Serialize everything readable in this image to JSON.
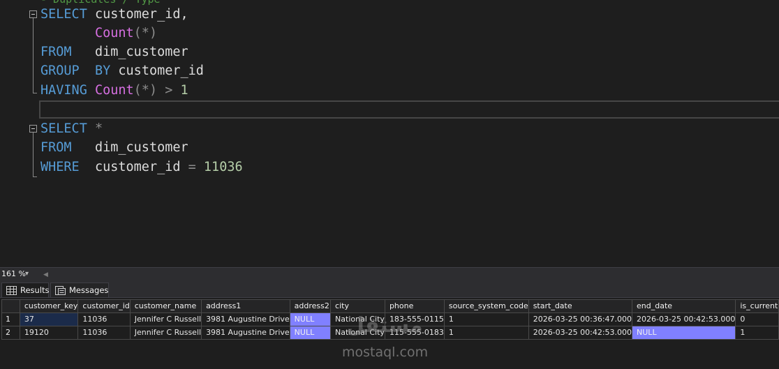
{
  "editor": {
    "top_partial": "- Duplicates / Type",
    "lines": [
      {
        "tokens": [
          [
            "kw",
            "SELECT"
          ],
          [
            "pl",
            " customer_id,"
          ]
        ]
      },
      {
        "tokens": [
          [
            "pl",
            "       "
          ],
          [
            "fn",
            "Count"
          ],
          [
            "op",
            "(*)"
          ]
        ]
      },
      {
        "tokens": [
          [
            "kw",
            "FROM"
          ],
          [
            "pl",
            "   dim_customer"
          ]
        ]
      },
      {
        "tokens": [
          [
            "kw",
            "GROUP"
          ],
          [
            "pl",
            "  "
          ],
          [
            "kw",
            "BY"
          ],
          [
            "pl",
            " customer_id"
          ]
        ]
      },
      {
        "tokens": [
          [
            "kw",
            "HAVING"
          ],
          [
            "pl",
            " "
          ],
          [
            "fn",
            "Count"
          ],
          [
            "op",
            "(*) > "
          ],
          [
            "num",
            "1"
          ]
        ]
      },
      {
        "tokens": []
      },
      {
        "tokens": [
          [
            "kw",
            "SELECT"
          ],
          [
            "pl",
            " "
          ],
          [
            "op",
            "*"
          ]
        ]
      },
      {
        "tokens": [
          [
            "kw",
            "FROM"
          ],
          [
            "pl",
            "   dim_customer"
          ]
        ]
      },
      {
        "tokens": [
          [
            "kw",
            "WHERE"
          ],
          [
            "pl",
            "  customer_id "
          ],
          [
            "op",
            "="
          ],
          [
            "pl",
            " "
          ],
          [
            "num",
            "11036"
          ]
        ]
      }
    ]
  },
  "zoom": {
    "level": "161 %",
    "dropdown_icon": "chevron-down-icon"
  },
  "tabs": {
    "results": "Results",
    "messages": "Messages"
  },
  "grid": {
    "columns": [
      "customer_key",
      "customer_id",
      "customer_name",
      "address1",
      "address2",
      "city",
      "phone",
      "source_system_code",
      "start_date",
      "end_date",
      "is_current"
    ],
    "rows": [
      {
        "num": "1",
        "cells": [
          "37",
          "11036",
          "Jennifer C Russell",
          "3981 Augustine Drive",
          "NULL",
          "National City",
          "183-555-0115",
          "1",
          "2026-03-25 00:36:47.000",
          "2026-03-25 00:42:53.000",
          "0"
        ]
      },
      {
        "num": "2",
        "cells": [
          "19120",
          "11036",
          "Jennifer C Russell",
          "3981 Augustine Drive",
          "NULL",
          "National City",
          "115-555-0183",
          "1",
          "2026-03-25 00:42:53.000",
          "NULL",
          "1"
        ]
      }
    ]
  },
  "watermark": {
    "logo": "مستقل",
    "text": "mostaql.com"
  },
  "colors": {
    "keyword": "#569cd6",
    "function": "#d66fe1",
    "number": "#b5cea8",
    "null_cell": "#8080ff"
  }
}
